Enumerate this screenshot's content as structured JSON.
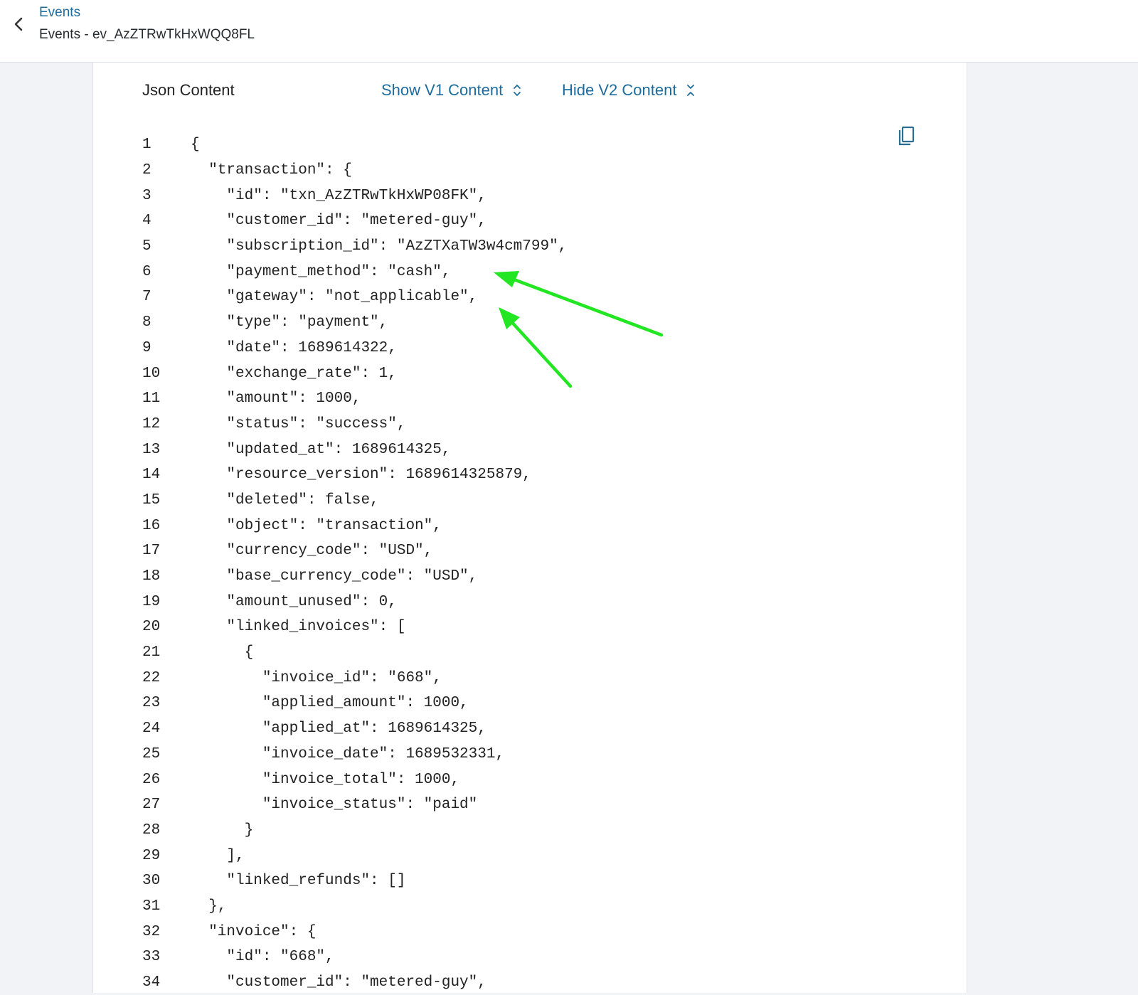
{
  "header": {
    "breadcrumb": "Events",
    "title": "Events - ev_AzZTRwTkHxWQQ8FL"
  },
  "panel": {
    "json_label": "Json Content",
    "show_v1_label": "Show V1 Content",
    "hide_v2_label": "Hide V2 Content"
  },
  "annotation_color": "#22e622",
  "code_lines": [
    {
      "n": "1",
      "t": "{"
    },
    {
      "n": "2",
      "t": "  \"transaction\": {"
    },
    {
      "n": "3",
      "t": "    \"id\": \"txn_AzZTRwTkHxWP08FK\","
    },
    {
      "n": "4",
      "t": "    \"customer_id\": \"metered-guy\","
    },
    {
      "n": "5",
      "t": "    \"subscription_id\": \"AzZTXaTW3w4cm799\","
    },
    {
      "n": "6",
      "t": "    \"payment_method\": \"cash\","
    },
    {
      "n": "7",
      "t": "    \"gateway\": \"not_applicable\","
    },
    {
      "n": "8",
      "t": "    \"type\": \"payment\","
    },
    {
      "n": "9",
      "t": "    \"date\": 1689614322,"
    },
    {
      "n": "10",
      "t": "    \"exchange_rate\": 1,"
    },
    {
      "n": "11",
      "t": "    \"amount\": 1000,"
    },
    {
      "n": "12",
      "t": "    \"status\": \"success\","
    },
    {
      "n": "13",
      "t": "    \"updated_at\": 1689614325,"
    },
    {
      "n": "14",
      "t": "    \"resource_version\": 1689614325879,"
    },
    {
      "n": "15",
      "t": "    \"deleted\": false,"
    },
    {
      "n": "16",
      "t": "    \"object\": \"transaction\","
    },
    {
      "n": "17",
      "t": "    \"currency_code\": \"USD\","
    },
    {
      "n": "18",
      "t": "    \"base_currency_code\": \"USD\","
    },
    {
      "n": "19",
      "t": "    \"amount_unused\": 0,"
    },
    {
      "n": "20",
      "t": "    \"linked_invoices\": ["
    },
    {
      "n": "21",
      "t": "      {"
    },
    {
      "n": "22",
      "t": "        \"invoice_id\": \"668\","
    },
    {
      "n": "23",
      "t": "        \"applied_amount\": 1000,"
    },
    {
      "n": "24",
      "t": "        \"applied_at\": 1689614325,"
    },
    {
      "n": "25",
      "t": "        \"invoice_date\": 1689532331,"
    },
    {
      "n": "26",
      "t": "        \"invoice_total\": 1000,"
    },
    {
      "n": "27",
      "t": "        \"invoice_status\": \"paid\""
    },
    {
      "n": "28",
      "t": "      }"
    },
    {
      "n": "29",
      "t": "    ],"
    },
    {
      "n": "30",
      "t": "    \"linked_refunds\": []"
    },
    {
      "n": "31",
      "t": "  },"
    },
    {
      "n": "32",
      "t": "  \"invoice\": {"
    },
    {
      "n": "33",
      "t": "    \"id\": \"668\","
    },
    {
      "n": "34",
      "t": "    \"customer_id\": \"metered-guy\","
    }
  ]
}
